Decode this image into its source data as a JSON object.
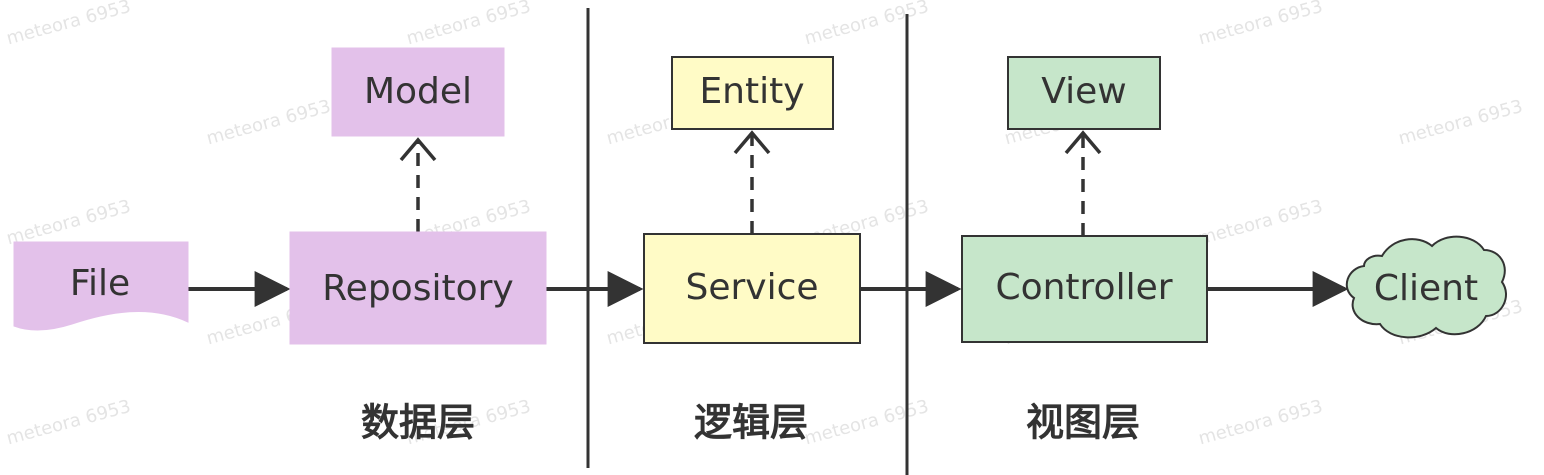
{
  "nodes": {
    "file": {
      "label": "File",
      "fill": "#e3c1ea",
      "stroke": "#e3c1ea"
    },
    "repository": {
      "label": "Repository",
      "fill": "#e3c1ea",
      "stroke": "#e3c1ea"
    },
    "model": {
      "label": "Model",
      "fill": "#e3c1ea",
      "stroke": "#e3c1ea"
    },
    "service": {
      "label": "Service",
      "fill": "#fffbc6",
      "stroke": "#333333"
    },
    "entity": {
      "label": "Entity",
      "fill": "#fffbc6",
      "stroke": "#333333"
    },
    "controller": {
      "label": "Controller",
      "fill": "#c6e6ca",
      "stroke": "#333333"
    },
    "view": {
      "label": "View",
      "fill": "#c6e6ca",
      "stroke": "#333333"
    },
    "client": {
      "label": "Client",
      "fill": "#c6e6ca",
      "stroke": "#333333"
    }
  },
  "layers": {
    "data": "数据层",
    "logic": "逻辑层",
    "view": "视图层"
  },
  "watermark": "meteora 6953",
  "colors": {
    "line": "#333333"
  }
}
